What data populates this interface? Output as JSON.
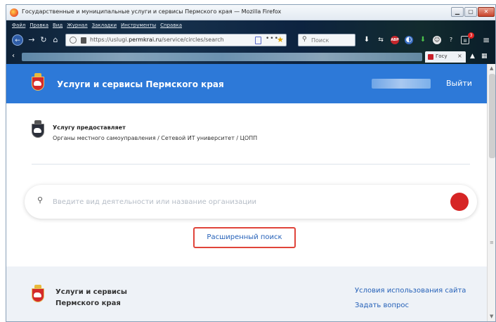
{
  "window": {
    "title": "Государственные и муниципальные услуги и сервисы Пермского края — Mozilla Firefox",
    "min_glyph": "▁",
    "max_glyph": "▢",
    "close_glyph": "✕"
  },
  "menubar": [
    "Файл",
    "Правка",
    "Вид",
    "Журнал",
    "Закладки",
    "Инструменты",
    "Справка"
  ],
  "navigation": {
    "back_glyph": "←",
    "forward_glyph": "→",
    "reload_glyph": "↻",
    "home_glyph": "⌂"
  },
  "urlbar": {
    "prefix": "https://uslugi.",
    "domain": "permkrai.ru",
    "path": "/service/circles/search",
    "more_glyph": "•••",
    "star_glyph": "★"
  },
  "searchbar": {
    "placeholder": "Поиск",
    "icon_glyph": "⚲"
  },
  "toolbar_icons": {
    "download": "⬇",
    "sync": "⇆",
    "abp": "ABP",
    "ext1": "◐",
    "ext2": "⬇",
    "ext3": "☺",
    "ext4": "?",
    "ext5": "▤",
    "badge": "3",
    "menu": "≡"
  },
  "tabs": {
    "left_arrow": "‹",
    "active_label": "Госу",
    "close_glyph": "×",
    "pin_glyph": "▲",
    "grid_glyph": "▦"
  },
  "site_header": {
    "title": "Услуги и сервисы Пермского края",
    "logout": "Выйти"
  },
  "provider": {
    "label": "Услугу предоставляет",
    "path": "Органы местного самоуправления / Сетевой ИТ университет / ЦОПП"
  },
  "search": {
    "icon_glyph": "⚲",
    "placeholder": "Введите вид деятельности или название организации",
    "value": ""
  },
  "advanced_search": {
    "label": "Расширенный поиск"
  },
  "footer": {
    "title_line1": "Услуги и сервисы",
    "title_line2": "Пермского края",
    "terms_link": "Условия использования сайта",
    "ask_link": "Задать вопрос"
  },
  "scrollbar": {
    "up_glyph": "▲",
    "grip_glyph": "≡",
    "down_glyph": "▼"
  },
  "colors": {
    "header_blue": "#2d79d8",
    "link_blue": "#2561b8",
    "accent_red": "#d62525",
    "highlight_border": "#e0443a"
  }
}
